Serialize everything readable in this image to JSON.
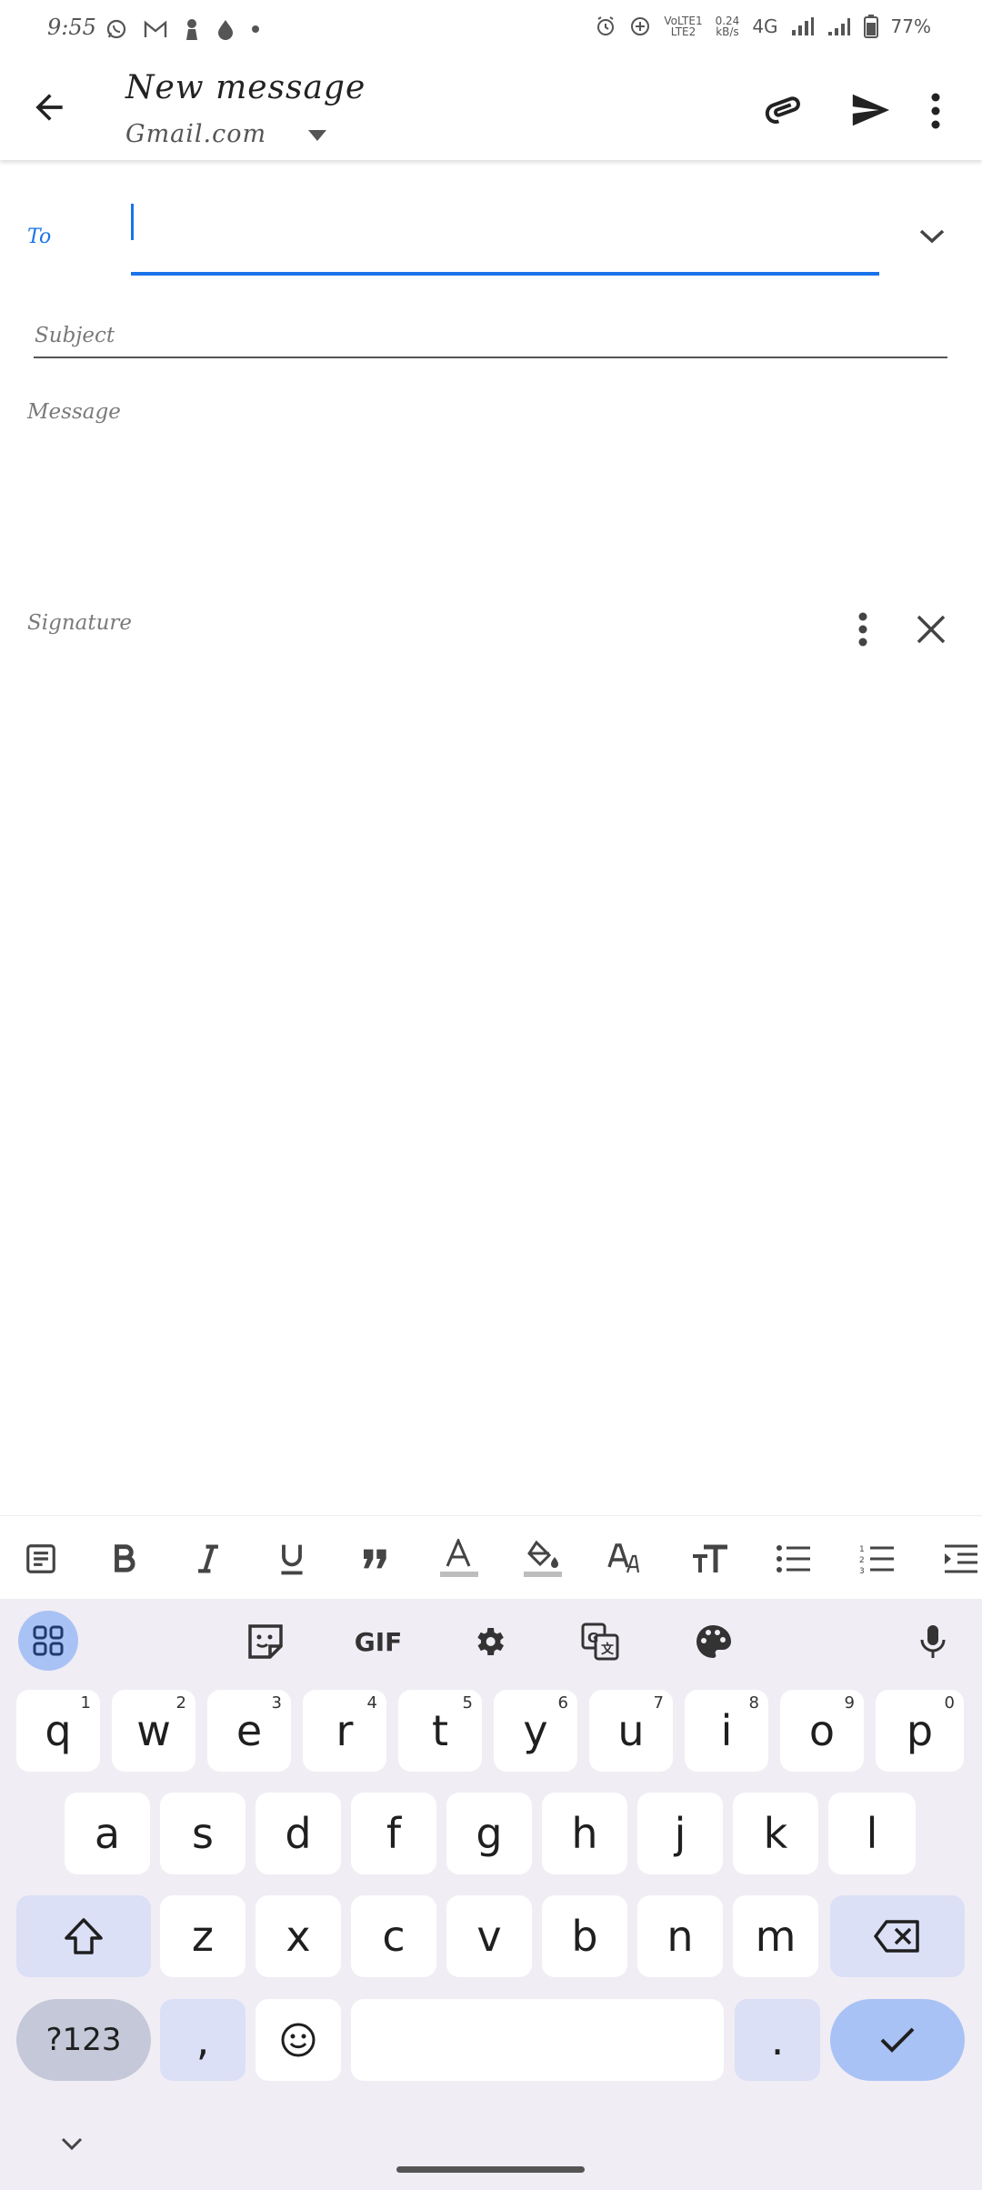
{
  "status_bar": {
    "time": "9:55",
    "left_icons": [
      "whatsapp-icon",
      "gmail-icon",
      "person-icon",
      "drop-icon",
      "dot-icon"
    ],
    "volte": "VoLTE1",
    "lte": "LTE2",
    "speed_value": "0.24",
    "speed_unit": "kB/s",
    "network": "4G",
    "battery": "77%"
  },
  "app_bar": {
    "title": "New message",
    "account": "Gmail.com"
  },
  "compose": {
    "to_label": "To",
    "to_value": "",
    "subject_placeholder": "Subject",
    "message_placeholder": "Message",
    "signature_label": "Signature"
  },
  "format_toolbar": [
    "notes-icon",
    "bold-icon",
    "italic-icon",
    "underline-icon",
    "quote-icon",
    "text-color-icon",
    "fill-color-icon",
    "font-style-icon",
    "text-size-icon",
    "bullet-list-icon",
    "numbered-list-icon",
    "indent-icon"
  ],
  "keyboard": {
    "toolbar": [
      "apps-grid-icon",
      "sticker-icon",
      "GIF",
      "settings-icon",
      "translate-icon",
      "palette-icon",
      "mic-icon"
    ],
    "gif_label": "GIF",
    "row1": [
      "q",
      "w",
      "e",
      "r",
      "t",
      "y",
      "u",
      "i",
      "o",
      "p"
    ],
    "row1_hints": [
      "1",
      "2",
      "3",
      "4",
      "5",
      "6",
      "7",
      "8",
      "9",
      "0"
    ],
    "row2": [
      "a",
      "s",
      "d",
      "f",
      "g",
      "h",
      "j",
      "k",
      "l"
    ],
    "row3": [
      "z",
      "x",
      "c",
      "v",
      "b",
      "n",
      "m"
    ],
    "symbols_label": "?123",
    "comma_label": ",",
    "period_label": ".",
    "space_label": ""
  },
  "colors": {
    "accent": "#1a73e8",
    "keyboard_bg": "#f0edf4",
    "modifier_key": "#dbe0f6",
    "enter_key": "#a9c2f5"
  }
}
